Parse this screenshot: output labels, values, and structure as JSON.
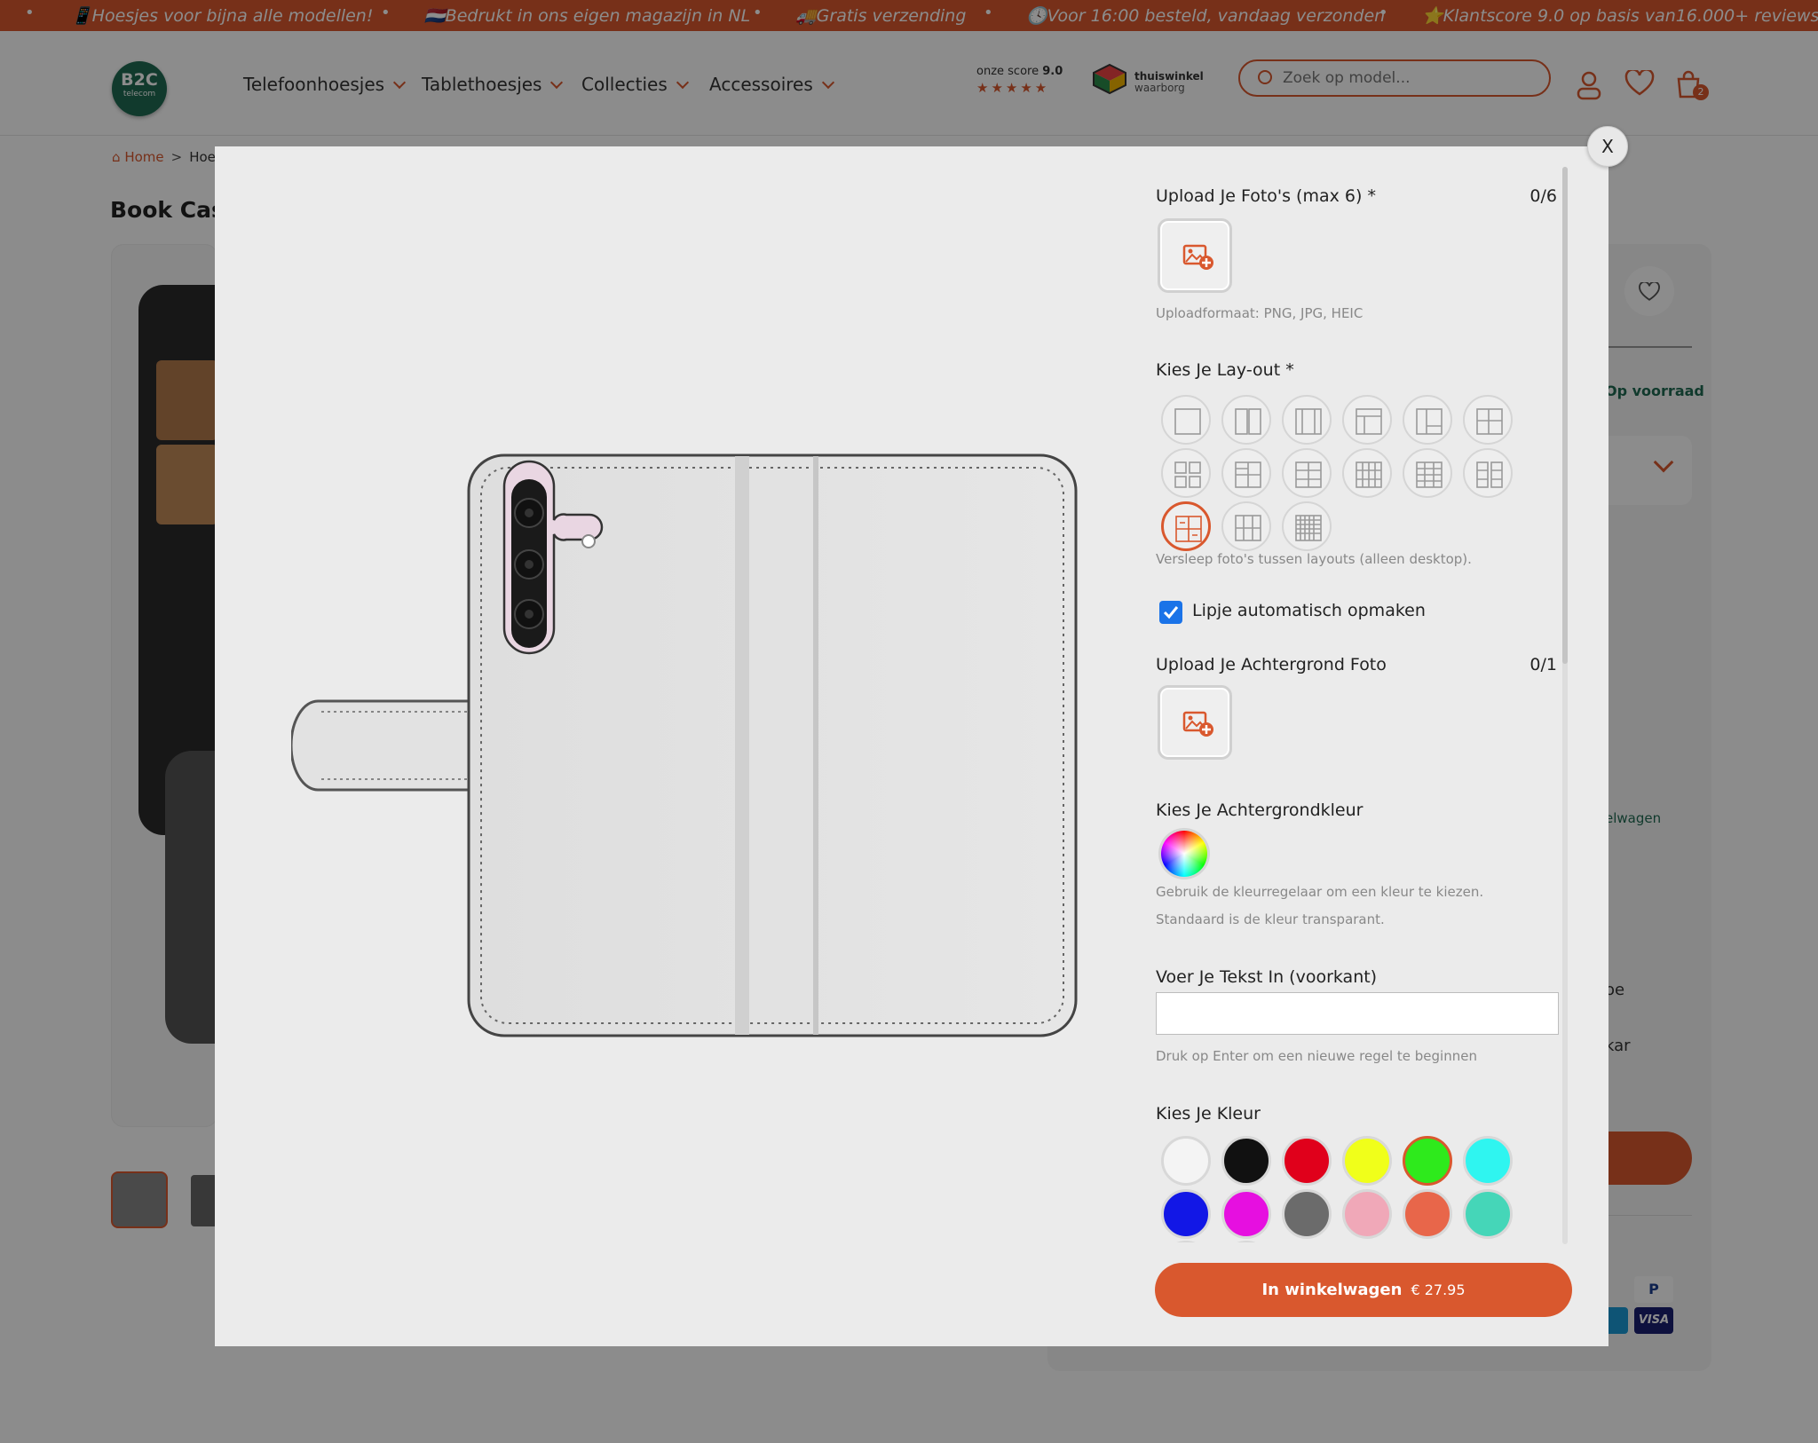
{
  "announcement": {
    "items": [
      "📱Hoesjes voor bijna alle modellen!",
      "🇳🇱Bedrukt in ons eigen magazijn in NL",
      "🚚Gratis verzending",
      "🕓Voor 16:00 besteld, vandaag verzonden",
      "⭐Klantscore 9.0 op basis van16.000+ reviews"
    ],
    "separator": "•"
  },
  "header": {
    "logo_text": "B2C",
    "logo_sub": "telecom",
    "nav": [
      "Telefoonhoesjes",
      "Tablethoesjes",
      "Collecties",
      "Accessoires"
    ],
    "score_label": "onze score",
    "score_value": "9.0",
    "stars": "★★★★★",
    "trust_line1": "thuiswinkel",
    "trust_line2": "waarborg",
    "search_placeholder": "Zoek op model...",
    "cart_count": "2"
  },
  "breadcrumb": {
    "home": "Home",
    "separator": ">",
    "current": "Hoes"
  },
  "product_title": "Book Case",
  "background_right": {
    "stock": "Op voorraad",
    "link1": "elwagen",
    "text1": "oe",
    "text2": "kar"
  },
  "modal": {
    "close_label": "X",
    "upload_photos": {
      "label": "Upload Je Foto's (max 6) *",
      "count": "0/6",
      "hint": "Uploadformaat: PNG, JPG, HEIC"
    },
    "layout": {
      "label": "Kies Je Lay-out *",
      "hint": "Versleep foto's tussen layouts (alleen desktop).",
      "selected_index": 12
    },
    "auto_format": {
      "label": "Lipje automatisch opmaken",
      "checked": true
    },
    "upload_background": {
      "label": "Upload Je Achtergrond Foto",
      "count": "0/1"
    },
    "background_color": {
      "label": "Kies Je Achtergrondkleur",
      "hint": "Gebruik de kleurregelaar om een kleur te kiezen. Standaard is de kleur transparant."
    },
    "text_front": {
      "label": "Voer Je Tekst In (voorkant)",
      "value": "",
      "hint": "Druk op Enter om een nieuwe regel te beginnen"
    },
    "text_color": {
      "label": "Kies Je Kleur",
      "colors": [
        "#f4f4f4",
        "#111111",
        "#e0001b",
        "#f0ff1a",
        "#2eea1c",
        "#2ff5f0",
        "#1217e6",
        "#e60fe0",
        "#6b6b6b",
        "#f0a8b8",
        "#e8664a",
        "#45d6b8"
      ],
      "selected_index": 4
    },
    "cart_button": {
      "label": "In winkelwagen",
      "price": "€ 27.95"
    }
  }
}
